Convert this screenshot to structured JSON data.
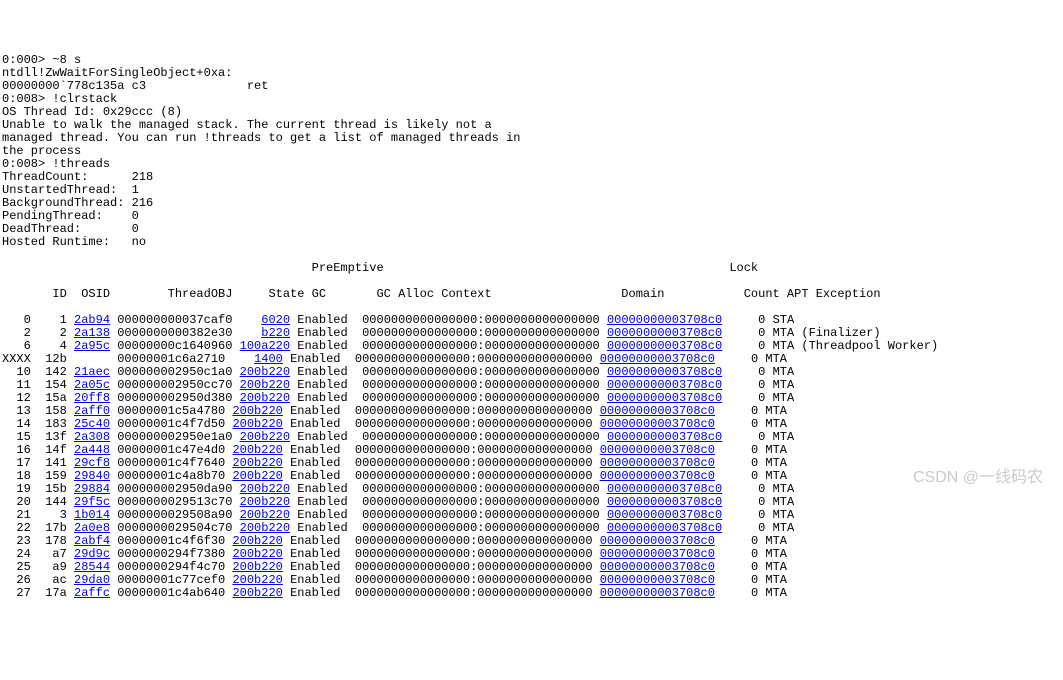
{
  "preamble": [
    "0:000> ~8 s",
    "ntdll!ZwWaitForSingleObject+0xa:",
    "00000000`778c135a c3              ret",
    "0:008> !clrstack",
    "OS Thread Id: 0x29ccc (8)",
    "Unable to walk the managed stack. The current thread is likely not a",
    "managed thread. You can run !threads to get a list of managed threads in",
    "the process",
    "0:008> !threads",
    "ThreadCount:      218",
    "UnstartedThread:  1",
    "BackgroundThread: 216",
    "PendingThread:    0",
    "DeadThread:       0",
    "Hosted Runtime:   no"
  ],
  "header1": "                                           PreEmptive                                                Lock",
  "header2": "       ID  OSID        ThreadOBJ     State GC       GC Alloc Context                  Domain           Count APT Exception",
  "rows": [
    {
      "idx": "   0",
      "id": "    1",
      "osid": "2ab94",
      "obj": "000000000037caf0",
      "state": "6020",
      "stpad": "   ",
      "enabled": "Enabled ",
      "ctx": "0000000000000000:0000000000000000",
      "dom": "00000000003708c0",
      "cnt": "     0",
      "apt": "STA",
      "exc": ""
    },
    {
      "idx": "   2",
      "id": "    2",
      "osid": "2a138",
      "obj": "0000000000382e30",
      "state": "b220",
      "stpad": "   ",
      "enabled": "Enabled ",
      "ctx": "0000000000000000:0000000000000000",
      "dom": "00000000003708c0",
      "cnt": "     0",
      "apt": "MTA",
      "exc": "(Finalizer)"
    },
    {
      "idx": "   6",
      "id": "    4",
      "osid": "2a95c",
      "obj": "00000000c1640960",
      "state": "100a220",
      "stpad": "",
      "enabled": "Enabled ",
      "ctx": "0000000000000000:0000000000000000",
      "dom": "00000000003708c0",
      "cnt": "     0",
      "apt": "MTA",
      "exc": "(Threadpool Worker)"
    },
    {
      "idx": "XXXX",
      "id": "  12b",
      "osid": "     ",
      "obj": "00000001c6a2710",
      "state": "1400",
      "stpad": "   ",
      "enabled": "Enabled ",
      "ctx": "0000000000000000:0000000000000000",
      "dom": "00000000003708c0",
      "cnt": "     0",
      "apt": "MTA",
      "exc": ""
    },
    {
      "idx": "  10",
      "id": "  142",
      "osid": "21aec",
      "obj": "000000002950c1a0",
      "state": "200b220",
      "stpad": "",
      "enabled": "Enabled ",
      "ctx": "0000000000000000:0000000000000000",
      "dom": "00000000003708c0",
      "cnt": "     0",
      "apt": "MTA",
      "exc": ""
    },
    {
      "idx": "  11",
      "id": "  154",
      "osid": "2a05c",
      "obj": "000000002950cc70",
      "state": "200b220",
      "stpad": "",
      "enabled": "Enabled ",
      "ctx": "0000000000000000:0000000000000000",
      "dom": "00000000003708c0",
      "cnt": "     0",
      "apt": "MTA",
      "exc": ""
    },
    {
      "idx": "  12",
      "id": "  15a",
      "osid": "20ff8",
      "obj": "000000002950d380",
      "state": "200b220",
      "stpad": "",
      "enabled": "Enabled ",
      "ctx": "0000000000000000:0000000000000000",
      "dom": "00000000003708c0",
      "cnt": "     0",
      "apt": "MTA",
      "exc": ""
    },
    {
      "idx": "  13",
      "id": "  158",
      "osid": "2aff0",
      "obj": "00000001c5a4780",
      "state": "200b220",
      "stpad": "",
      "enabled": "Enabled ",
      "ctx": "0000000000000000:0000000000000000",
      "dom": "00000000003708c0",
      "cnt": "     0",
      "apt": "MTA",
      "exc": ""
    },
    {
      "idx": "  14",
      "id": "  183",
      "osid": "25c40",
      "obj": "00000001c4f7d50",
      "state": "200b220",
      "stpad": "",
      "enabled": "Enabled ",
      "ctx": "0000000000000000:0000000000000000",
      "dom": "00000000003708c0",
      "cnt": "     0",
      "apt": "MTA",
      "exc": ""
    },
    {
      "idx": "  15",
      "id": "  13f",
      "osid": "2a308",
      "obj": "000000002950e1a0",
      "state": "200b220",
      "stpad": "",
      "enabled": "Enabled ",
      "ctx": "0000000000000000:0000000000000000",
      "dom": "00000000003708c0",
      "cnt": "     0",
      "apt": "MTA",
      "exc": ""
    },
    {
      "idx": "  16",
      "id": "  14f",
      "osid": "2a448",
      "obj": "00000001c47e4d0",
      "state": "200b220",
      "stpad": "",
      "enabled": "Enabled ",
      "ctx": "0000000000000000:0000000000000000",
      "dom": "00000000003708c0",
      "cnt": "     0",
      "apt": "MTA",
      "exc": ""
    },
    {
      "idx": "  17",
      "id": "  141",
      "osid": "29cf8",
      "obj": "00000001c4f7640",
      "state": "200b220",
      "stpad": "",
      "enabled": "Enabled ",
      "ctx": "0000000000000000:0000000000000000",
      "dom": "00000000003708c0",
      "cnt": "     0",
      "apt": "MTA",
      "exc": ""
    },
    {
      "idx": "  18",
      "id": "  159",
      "osid": "29840",
      "obj": "00000001c4a8b70",
      "state": "200b220",
      "stpad": "",
      "enabled": "Enabled ",
      "ctx": "0000000000000000:0000000000000000",
      "dom": "00000000003708c0",
      "cnt": "     0",
      "apt": "MTA",
      "exc": ""
    },
    {
      "idx": "  19",
      "id": "  15b",
      "osid": "29884",
      "obj": "000000002950da90",
      "state": "200b220",
      "stpad": "",
      "enabled": "Enabled ",
      "ctx": "0000000000000000:0000000000000000",
      "dom": "00000000003708c0",
      "cnt": "     0",
      "apt": "MTA",
      "exc": ""
    },
    {
      "idx": "  20",
      "id": "  144",
      "osid": "29f5c",
      "obj": "0000000029513c70",
      "state": "200b220",
      "stpad": "",
      "enabled": "Enabled ",
      "ctx": "0000000000000000:0000000000000000",
      "dom": "00000000003708c0",
      "cnt": "     0",
      "apt": "MTA",
      "exc": ""
    },
    {
      "idx": "  21",
      "id": "    3",
      "osid": "1b014",
      "obj": "0000000029508a90",
      "state": "200b220",
      "stpad": "",
      "enabled": "Enabled ",
      "ctx": "0000000000000000:0000000000000000",
      "dom": "00000000003708c0",
      "cnt": "     0",
      "apt": "MTA",
      "exc": ""
    },
    {
      "idx": "  22",
      "id": "  17b",
      "osid": "2a0e8",
      "obj": "0000000029504c70",
      "state": "200b220",
      "stpad": "",
      "enabled": "Enabled ",
      "ctx": "0000000000000000:0000000000000000",
      "dom": "00000000003708c0",
      "cnt": "     0",
      "apt": "MTA",
      "exc": ""
    },
    {
      "idx": "  23",
      "id": "  178",
      "osid": "2abf4",
      "obj": "00000001c4f6f30",
      "state": "200b220",
      "stpad": "",
      "enabled": "Enabled ",
      "ctx": "0000000000000000:0000000000000000",
      "dom": "00000000003708c0",
      "cnt": "     0",
      "apt": "MTA",
      "exc": ""
    },
    {
      "idx": "  24",
      "id": "   a7",
      "osid": "29d9c",
      "obj": "0000000294f7380",
      "state": "200b220",
      "stpad": "",
      "enabled": "Enabled ",
      "ctx": "0000000000000000:0000000000000000",
      "dom": "00000000003708c0",
      "cnt": "     0",
      "apt": "MTA",
      "exc": ""
    },
    {
      "idx": "  25",
      "id": "   a9",
      "osid": "28544",
      "obj": "0000000294f4c70",
      "state": "200b220",
      "stpad": "",
      "enabled": "Enabled ",
      "ctx": "0000000000000000:0000000000000000",
      "dom": "00000000003708c0",
      "cnt": "     0",
      "apt": "MTA",
      "exc": ""
    },
    {
      "idx": "  26",
      "id": "   ac",
      "osid": "29da0",
      "obj": "00000001c77cef0",
      "state": "200b220",
      "stpad": "",
      "enabled": "Enabled ",
      "ctx": "0000000000000000:0000000000000000",
      "dom": "00000000003708c0",
      "cnt": "     0",
      "apt": "MTA",
      "exc": ""
    },
    {
      "idx": "  27",
      "id": "  17a",
      "osid": "2affc",
      "obj": "00000001c4ab640",
      "state": "200b220",
      "stpad": "",
      "enabled": "Enabled ",
      "ctx": "0000000000000000:0000000000000000",
      "dom": "00000000003708c0",
      "cnt": "     0",
      "apt": "MTA",
      "exc": ""
    }
  ],
  "watermark": "CSDN @一线码农"
}
